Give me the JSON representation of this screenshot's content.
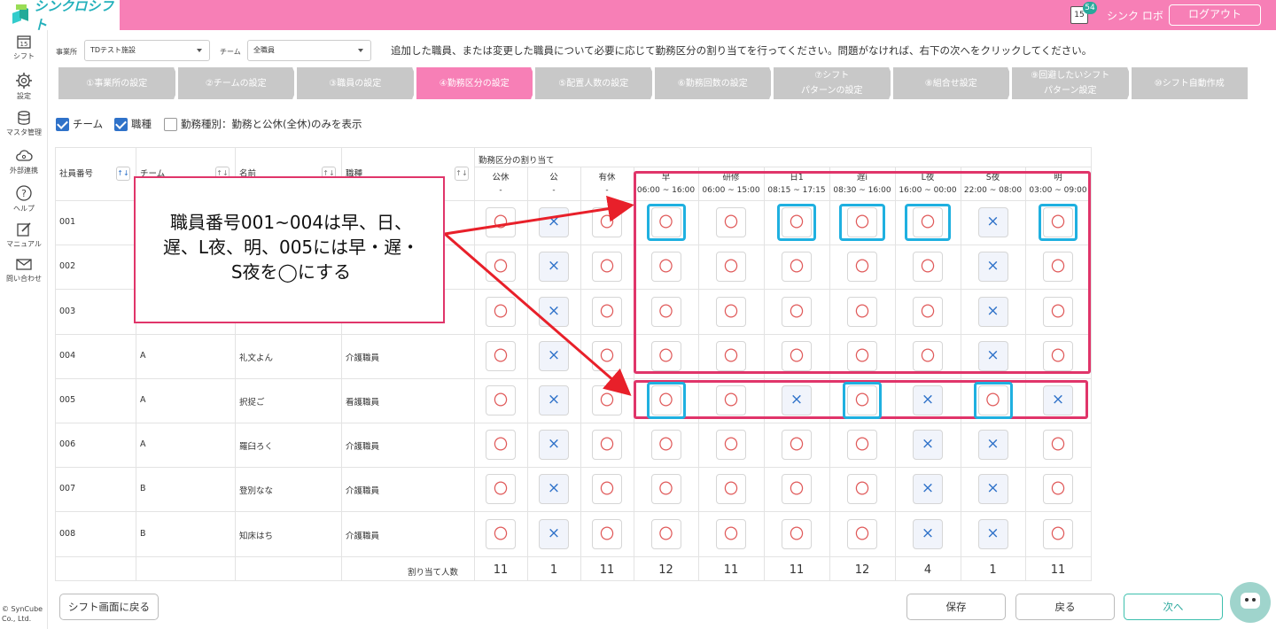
{
  "app": {
    "name": "シンクロシフト",
    "notification_count": "54",
    "calendar_day": "15",
    "user": "シンク ロボ",
    "logout": "ログアウト"
  },
  "sidebar": [
    {
      "label": "シフト",
      "icon": "calendar-icon"
    },
    {
      "label": "設定",
      "icon": "gear-icon"
    },
    {
      "label": "マスタ管理",
      "icon": "database-icon"
    },
    {
      "label": "外部連携",
      "icon": "cloud-link-icon"
    },
    {
      "label": "ヘルプ",
      "icon": "help-icon"
    },
    {
      "label": "マニュアル",
      "icon": "manual-edit-icon"
    },
    {
      "label": "問い合わせ",
      "icon": "mail-icon"
    }
  ],
  "copyright": [
    "© SynCube",
    "Co., Ltd."
  ],
  "filters": {
    "office_label": "事業所",
    "office_value": "TDテスト施設",
    "team_label": "チーム",
    "team_value": "全職員"
  },
  "instruction": "追加した職員、または変更した職員について必要に応じて勤務区分の割り当てを行ってください。問題がなければ、右下の次へをクリックしてください。",
  "steps": [
    "①事業所の設定",
    "②チームの設定",
    "③職員の設定",
    "④勤務区分の設定",
    "⑤配置人数の設定",
    "⑥勤務回数の設定",
    "⑦シフト\nパターンの設定",
    "⑧組合せ設定",
    "⑨回避したいシフト\nパターン設定",
    "⑩シフト自動作成"
  ],
  "active_step": 3,
  "checks": [
    {
      "label": "チーム",
      "checked": true
    },
    {
      "label": "職種",
      "checked": true
    },
    {
      "label": "勤務種別：勤務と公休(全休)のみを表示",
      "checked": false
    }
  ],
  "table": {
    "headers": {
      "id": "社員番号",
      "team": "チーム",
      "name": "名前",
      "job": "職種",
      "assign": "勤務区分の割り当て"
    },
    "shift_columns": [
      {
        "name": "公休",
        "time": "-"
      },
      {
        "name": "公",
        "time": "-"
      },
      {
        "name": "有休",
        "time": "-"
      },
      {
        "name": "早",
        "time": "06:00 ~ 16:00"
      },
      {
        "name": "研修",
        "time": "06:00 ~ 15:00"
      },
      {
        "name": "日1",
        "time": "08:15 ~ 17:15"
      },
      {
        "name": "遅i",
        "time": "08:30 ~ 16:00"
      },
      {
        "name": "L夜",
        "time": "16:00 ~ 00:00"
      },
      {
        "name": "S夜",
        "time": "22:00 ~ 08:00"
      },
      {
        "name": "明",
        "time": "03:00 ~ 09:00"
      }
    ],
    "rows": [
      {
        "id": "001",
        "team": "",
        "name": "",
        "job": "",
        "marks": [
          "〇",
          "×",
          "〇",
          "〇",
          "〇",
          "〇",
          "〇",
          "〇",
          "×",
          "〇"
        ]
      },
      {
        "id": "002",
        "team": "",
        "name": "",
        "job": "",
        "marks": [
          "〇",
          "×",
          "〇",
          "〇",
          "〇",
          "〇",
          "〇",
          "〇",
          "×",
          "〇"
        ]
      },
      {
        "id": "003",
        "team": "",
        "name": "",
        "job": "",
        "marks": [
          "〇",
          "×",
          "〇",
          "〇",
          "〇",
          "〇",
          "〇",
          "〇",
          "×",
          "〇"
        ]
      },
      {
        "id": "004",
        "team": "A",
        "name": "礼文よん",
        "job": "介護職員",
        "marks": [
          "〇",
          "×",
          "〇",
          "〇",
          "〇",
          "〇",
          "〇",
          "〇",
          "×",
          "〇"
        ]
      },
      {
        "id": "005",
        "team": "A",
        "name": "択捉ご",
        "job": "看護職員",
        "marks": [
          "〇",
          "×",
          "〇",
          "〇",
          "〇",
          "×",
          "〇",
          "×",
          "〇",
          "×"
        ]
      },
      {
        "id": "006",
        "team": "A",
        "name": "羅臼ろく",
        "job": "介護職員",
        "marks": [
          "〇",
          "×",
          "〇",
          "〇",
          "〇",
          "〇",
          "〇",
          "×",
          "×",
          "〇"
        ]
      },
      {
        "id": "007",
        "team": "B",
        "name": "登別なな",
        "job": "介護職員",
        "marks": [
          "〇",
          "×",
          "〇",
          "〇",
          "〇",
          "〇",
          "〇",
          "×",
          "×",
          "〇"
        ]
      },
      {
        "id": "008",
        "team": "B",
        "name": "知床はち",
        "job": "介護職員",
        "marks": [
          "〇",
          "×",
          "〇",
          "〇",
          "〇",
          "〇",
          "〇",
          "×",
          "×",
          "〇"
        ]
      }
    ],
    "totals_label": "割り当て人数",
    "totals": [
      "11",
      "1",
      "11",
      "12",
      "11",
      "11",
      "12",
      "4",
      "1",
      "11"
    ]
  },
  "callout": [
    "職員番号001~004は早、日、",
    "遅、L夜、明、005には早・遅・",
    "S夜を◯にする"
  ],
  "buttons": {
    "back_to_shift": "シフト画面に戻る",
    "save": "保存",
    "back": "戻る",
    "next": "次へ"
  },
  "colors": {
    "brand_pink": "#f77fb6",
    "active_step": "#f77fb6",
    "inactive_step": "#c8c8c8",
    "highlight_blue": "#1fb0e0",
    "annotation_red": "#e0356a",
    "check_blue": "#2f72c9"
  }
}
